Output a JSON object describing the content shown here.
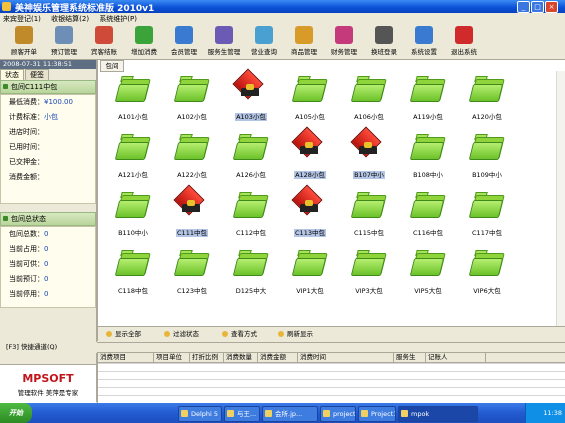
{
  "window": {
    "title": "美神娱乐管理系统标准版 2010v1",
    "minimize": "_",
    "maximize": "□",
    "close": "×"
  },
  "menu": [
    "来宾登记(1)",
    "收银结算(2)",
    "系统维护(P)"
  ],
  "toolbar": [
    {
      "label": "顾客开单",
      "icon": "customer-order-icon",
      "color": "#c08a2a"
    },
    {
      "label": "预订管理",
      "icon": "clock-icon",
      "color": "#6d8fb7"
    },
    {
      "label": "宾客结账",
      "icon": "checkout-icon",
      "color": "#d04a3a"
    },
    {
      "label": "增加消费",
      "icon": "add-consume-icon",
      "color": "#3aa43a"
    },
    {
      "label": "会员管理",
      "icon": "member-icon",
      "color": "#3a7ad0"
    },
    {
      "label": "服务生管理",
      "icon": "waiter-icon",
      "color": "#6b5bb5"
    },
    {
      "label": "营业查询",
      "icon": "search-icon",
      "color": "#4aa0d0"
    },
    {
      "label": "商品管理",
      "icon": "goods-icon",
      "color": "#d89b2a"
    },
    {
      "label": "财务管理",
      "icon": "finance-icon",
      "color": "#c43a7a"
    },
    {
      "label": "换班登录",
      "icon": "shift-login-icon",
      "color": "#555555"
    },
    {
      "label": "系统设置",
      "icon": "settings-icon",
      "color": "#3a7ad0"
    },
    {
      "label": "退出系统",
      "icon": "exit-icon",
      "color": "#d02a2a"
    }
  ],
  "left": {
    "datetime": "2008-07-31 11:38:51",
    "tabs": [
      "状态",
      "便签"
    ],
    "room_section_title": "包间C111中包",
    "fields": [
      {
        "label": "最低消费：",
        "value": "¥100.00"
      },
      {
        "label": "计费标准：",
        "value": "小包"
      },
      {
        "label": "进店时间：",
        "value": ""
      },
      {
        "label": "已用时间：",
        "value": ""
      },
      {
        "label": "已交押金：",
        "value": ""
      },
      {
        "label": "消费金额：",
        "value": ""
      }
    ],
    "stats_section_title": "包间总状态",
    "stats": [
      {
        "label": "包间总数：",
        "value": "0"
      },
      {
        "label": "当前占用：",
        "value": "0"
      },
      {
        "label": "当前可供：",
        "value": "0"
      },
      {
        "label": "当前预订：",
        "value": "0"
      },
      {
        "label": "当前停用：",
        "value": "0"
      }
    ],
    "brand": {
      "logo": "MPSOFT",
      "slogan": "管理软件 美萍是专家"
    }
  },
  "main": {
    "tab": "包间",
    "rooms": [
      {
        "name": "A101小包",
        "state": "free",
        "selected": false
      },
      {
        "name": "A102小包",
        "state": "free",
        "selected": false
      },
      {
        "name": "A103小包",
        "state": "busy",
        "selected": true
      },
      {
        "name": "A105小包",
        "state": "free",
        "selected": false
      },
      {
        "name": "A106小包",
        "state": "free",
        "selected": false
      },
      {
        "name": "A119小包",
        "state": "free",
        "selected": false
      },
      {
        "name": "A120小包",
        "state": "free",
        "selected": false
      },
      {
        "name": "A121小包",
        "state": "free",
        "selected": false
      },
      {
        "name": "A122小包",
        "state": "free",
        "selected": false
      },
      {
        "name": "A126小包",
        "state": "free",
        "selected": false
      },
      {
        "name": "A128小包",
        "state": "busy",
        "selected": true
      },
      {
        "name": "B107中小",
        "state": "busy",
        "selected": true
      },
      {
        "name": "B108中小",
        "state": "free",
        "selected": false
      },
      {
        "name": "B109中小",
        "state": "free",
        "selected": false
      },
      {
        "name": "B110中小",
        "state": "free",
        "selected": false
      },
      {
        "name": "C111中包",
        "state": "busy",
        "selected": true
      },
      {
        "name": "C112中包",
        "state": "free",
        "selected": false
      },
      {
        "name": "C113中包",
        "state": "busy",
        "selected": true
      },
      {
        "name": "C115中包",
        "state": "free",
        "selected": false
      },
      {
        "name": "C116中包",
        "state": "free",
        "selected": false
      },
      {
        "name": "C117中包",
        "state": "free",
        "selected": false
      },
      {
        "name": "C118中包",
        "state": "free",
        "selected": false
      },
      {
        "name": "C123中包",
        "state": "free",
        "selected": false
      },
      {
        "name": "D125中大",
        "state": "free",
        "selected": false
      },
      {
        "name": "VIP1大包",
        "state": "free",
        "selected": false
      },
      {
        "name": "VIP3大包",
        "state": "free",
        "selected": false
      },
      {
        "name": "VIP5大包",
        "state": "free",
        "selected": false
      },
      {
        "name": "VIP6大包",
        "state": "free",
        "selected": false
      }
    ],
    "buttons": [
      "显示全部",
      "过滤状态",
      "查看方式",
      "刷新显示"
    ]
  },
  "quick": {
    "label": "[F3] 快捷通道(Q)"
  },
  "table": {
    "columns": [
      "消费项目",
      "项目单位",
      "打折比例",
      "消费数量",
      "消费金额",
      "消费时间",
      "服务生",
      "记账人"
    ]
  },
  "taskbar": {
    "start": "开始",
    "tasks": [
      "Delphi 5",
      "与王...",
      "会所.jp...",
      "project",
      "Project1",
      "mpok"
    ],
    "clock": "11:38"
  }
}
